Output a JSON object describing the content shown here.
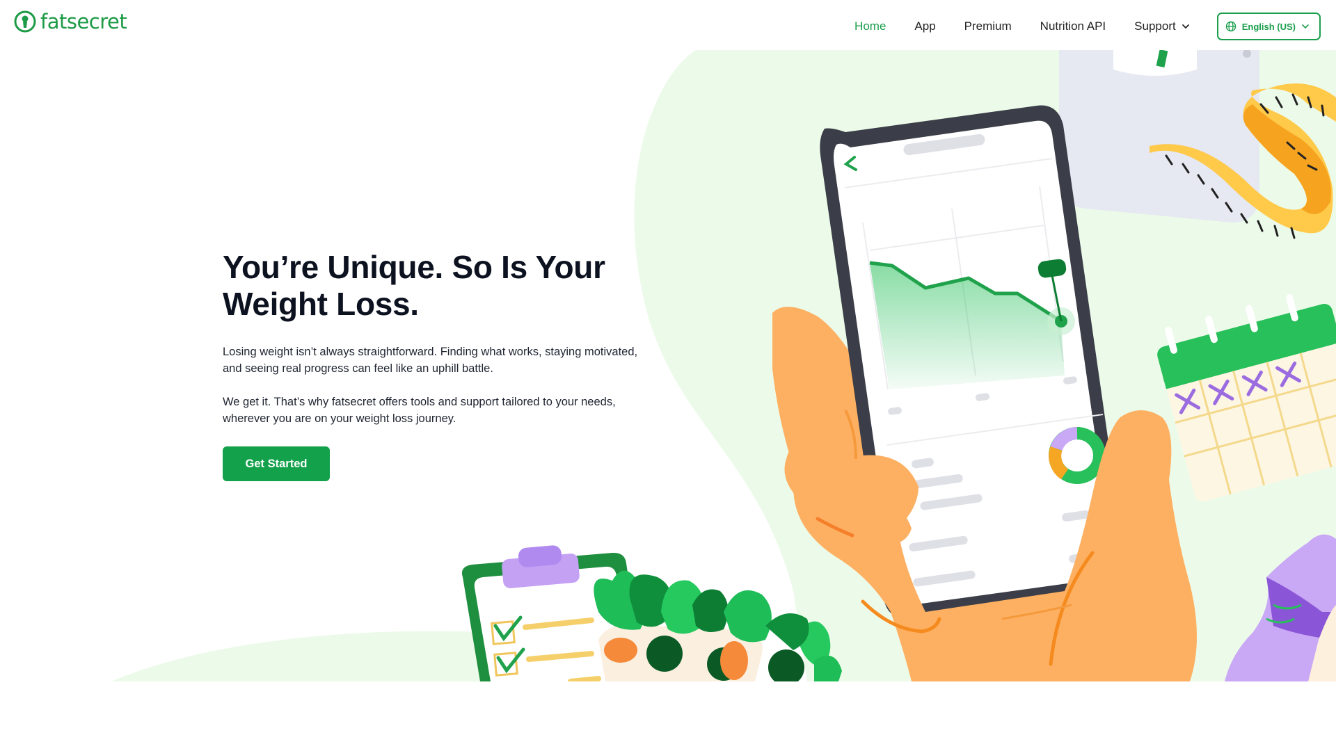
{
  "brand": {
    "name": "fatsecret",
    "logo_icon": "keyhole-person-icon",
    "accent_color": "#1a9e4b"
  },
  "nav": {
    "items": [
      {
        "label": "Home",
        "active": true
      },
      {
        "label": "App",
        "active": false
      },
      {
        "label": "Premium",
        "active": false
      },
      {
        "label": "Nutrition API",
        "active": false
      },
      {
        "label": "Support",
        "active": false,
        "dropdown": true
      }
    ],
    "language": {
      "label": "English (US)",
      "icon": "globe-icon"
    }
  },
  "hero": {
    "title_line1": "You’re Unique. So Is Your",
    "title_line2": "Weight Loss.",
    "paragraph1": "Losing weight isn’t always straightforward. Finding what works, staying motivated, and seeing real progress can feel like an uphill battle.",
    "paragraph2": "We get it. That’s why fatsecret offers tools and support tailored to your needs, wherever you are on your weight loss journey.",
    "cta_label": "Get Started",
    "cta_color": "#13a24b"
  },
  "illustration": {
    "subjects": [
      "hand-holding-phone",
      "weight-progress-chart",
      "donut-chart",
      "bathroom-scale",
      "measuring-tape",
      "calendar",
      "clipboard-checklist",
      "salad-bowl",
      "sneaker"
    ]
  }
}
